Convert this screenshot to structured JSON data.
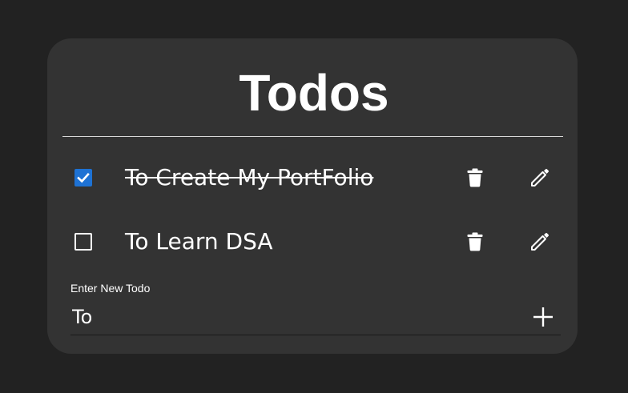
{
  "app": {
    "title": "Todos"
  },
  "todos": [
    {
      "text": "To Create My PortFolio",
      "completed": true
    },
    {
      "text": "To Learn DSA",
      "completed": false
    }
  ],
  "new_todo": {
    "label": "Enter New Todo",
    "value": "To"
  },
  "icons": {
    "checkbox_checked": "check-box-icon",
    "checkbox_unchecked": "check-box-outline-icon",
    "delete": "trash-icon",
    "edit": "pencil-icon",
    "add": "plus-icon"
  },
  "colors": {
    "background": "#222222",
    "card": "#333333",
    "text": "#ffffff",
    "accent": "#1e72d4"
  }
}
